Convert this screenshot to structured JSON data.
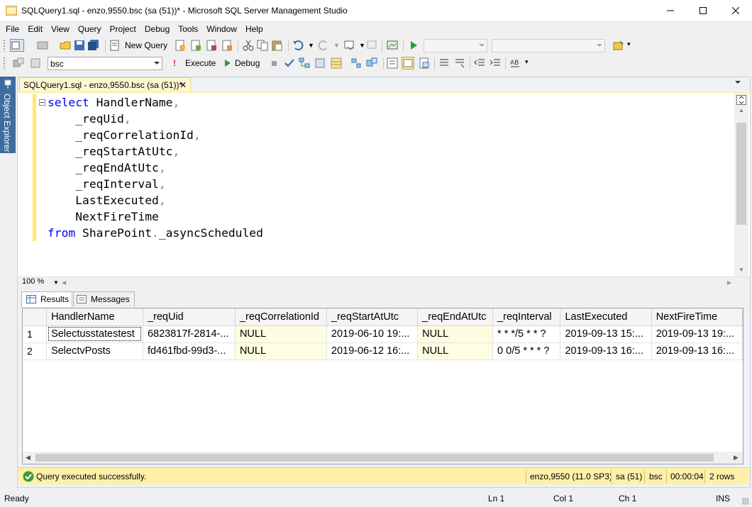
{
  "window": {
    "title": "SQLQuery1.sql - enzo,9550.bsc (sa (51))* - Microsoft SQL Server Management Studio"
  },
  "menu": [
    "File",
    "Edit",
    "View",
    "Query",
    "Project",
    "Debug",
    "Tools",
    "Window",
    "Help"
  ],
  "toolbar1": {
    "new_query_label": "New Query"
  },
  "toolbar2": {
    "database_value": "bsc",
    "execute_label": "Execute",
    "debug_label": "Debug"
  },
  "object_explorer_label": "Object Explorer",
  "document_tab": {
    "label": "SQLQuery1.sql - enzo,9550.bsc (sa (51))*",
    "close": "✕"
  },
  "editor": {
    "zoom": "100 %",
    "lines": [
      {
        "kw": "select",
        "text": " HandlerName",
        "punct": ","
      },
      {
        "kw": "",
        "text": "    _reqUid",
        "punct": ","
      },
      {
        "kw": "",
        "text": "    _reqCorrelationId",
        "punct": ","
      },
      {
        "kw": "",
        "text": "    _reqStartAtUtc",
        "punct": ","
      },
      {
        "kw": "",
        "text": "    _reqEndAtUtc",
        "punct": ","
      },
      {
        "kw": "",
        "text": "    _reqInterval",
        "punct": ","
      },
      {
        "kw": "",
        "text": "    LastExecuted",
        "punct": ","
      },
      {
        "kw": "",
        "text": "    NextFireTime",
        "punct": ""
      },
      {
        "kw": "from",
        "text": " SharePoint",
        "punct": ".",
        "tail": "_asyncScheduled"
      }
    ]
  },
  "results_tabs": {
    "results": "Results",
    "messages": "Messages"
  },
  "grid": {
    "columns": [
      "HandlerName",
      "_reqUid",
      "_reqCorrelationId",
      "_reqStartAtUtc",
      "_reqEndAtUtc",
      "_reqInterval",
      "LastExecuted",
      "NextFireTime"
    ],
    "rows": [
      {
        "num": "1",
        "cells": [
          "Selectusstatestest",
          "6823817f-2814-...",
          "NULL",
          "2019-06-10 19:...",
          "NULL",
          "* * */5 * * ?",
          "2019-09-13 15:...",
          "2019-09-13 19:..."
        ]
      },
      {
        "num": "2",
        "cells": [
          "SelectvPosts",
          "fd461fbd-99d3-...",
          "NULL",
          "2019-06-12 16:...",
          "NULL",
          "0 0/5 * * * ?",
          "2019-09-13 16:...",
          "2019-09-13 16:..."
        ]
      }
    ]
  },
  "query_status": {
    "message": "Query executed successfully.",
    "server": "enzo,9550 (11.0 SP3)",
    "user": "sa (51)",
    "database": "bsc",
    "elapsed": "00:00:04",
    "rows": "2 rows"
  },
  "status_bar": {
    "ready": "Ready",
    "ln": "Ln 1",
    "col": "Col 1",
    "ch": "Ch 1",
    "mode": "INS"
  }
}
